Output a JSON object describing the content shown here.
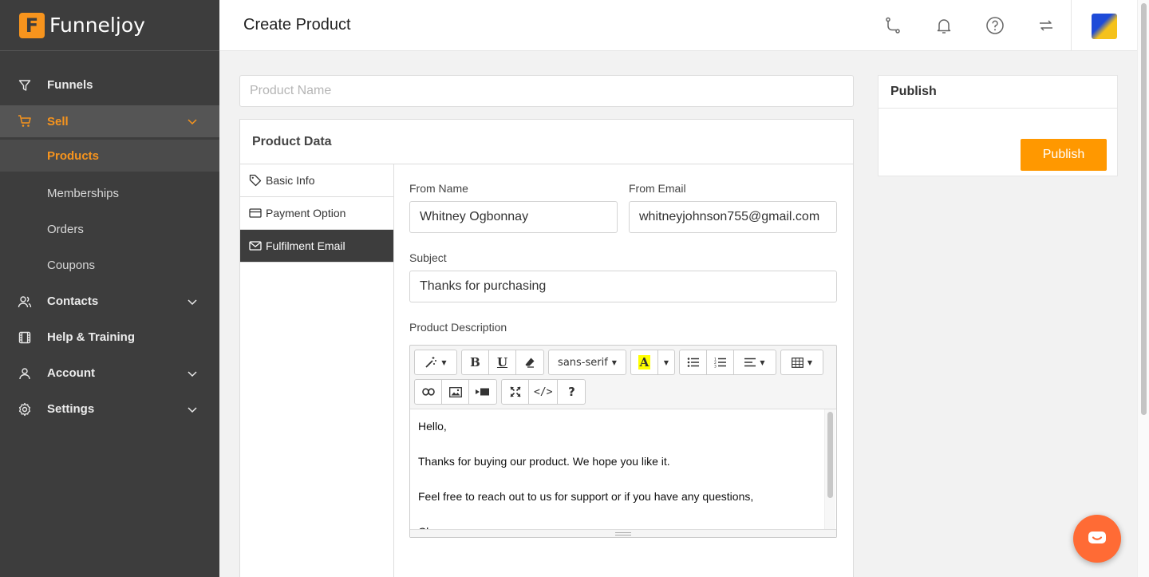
{
  "brand": {
    "mark": "F",
    "name": "Funneljoy"
  },
  "sidebar": {
    "items": [
      {
        "label": "Funnels",
        "icon": "funnel-icon"
      },
      {
        "label": "Sell",
        "icon": "cart-icon",
        "active": true,
        "expanded": true,
        "children": [
          {
            "label": "Products",
            "active": true
          },
          {
            "label": "Memberships"
          },
          {
            "label": "Orders"
          },
          {
            "label": "Coupons"
          }
        ]
      },
      {
        "label": "Contacts",
        "icon": "users-icon"
      },
      {
        "label": "Help & Training",
        "icon": "film-icon"
      },
      {
        "label": "Account",
        "icon": "user-icon"
      },
      {
        "label": "Settings",
        "icon": "gear-icon"
      }
    ]
  },
  "header": {
    "title": "Create Product",
    "icons": [
      "route-icon",
      "bell-icon",
      "help-icon",
      "sync-icon"
    ]
  },
  "product": {
    "name_placeholder": "Product Name",
    "name_value": ""
  },
  "product_data": {
    "title": "Product Data",
    "tabs": [
      {
        "label": "Basic Info",
        "icon": "tag-icon"
      },
      {
        "label": "Payment Option",
        "icon": "card-icon"
      },
      {
        "label": "Fulfilment Email",
        "icon": "mail-icon",
        "active": true
      }
    ],
    "form": {
      "from_name_label": "From Name",
      "from_name_value": "Whitney Ogbonnay",
      "from_email_label": "From Email",
      "from_email_value": "whitneyjohnson755@gmail.com",
      "subject_label": "Subject",
      "subject_value": "Thanks for purchasing",
      "description_label": "Product Description"
    },
    "editor": {
      "font_name": "sans-serif",
      "body": [
        "Hello,",
        "",
        "Thanks for buying our product. We hope you like it.",
        "",
        "Feel free to reach out to us for support or if you have any questions,",
        "",
        "Cheers"
      ]
    }
  },
  "publish": {
    "title": "Publish",
    "button_label": "Publish"
  },
  "colors": {
    "accent": "#ff9800",
    "sidebar_bg": "#3d3d3d",
    "chat": "#ff6b35"
  }
}
